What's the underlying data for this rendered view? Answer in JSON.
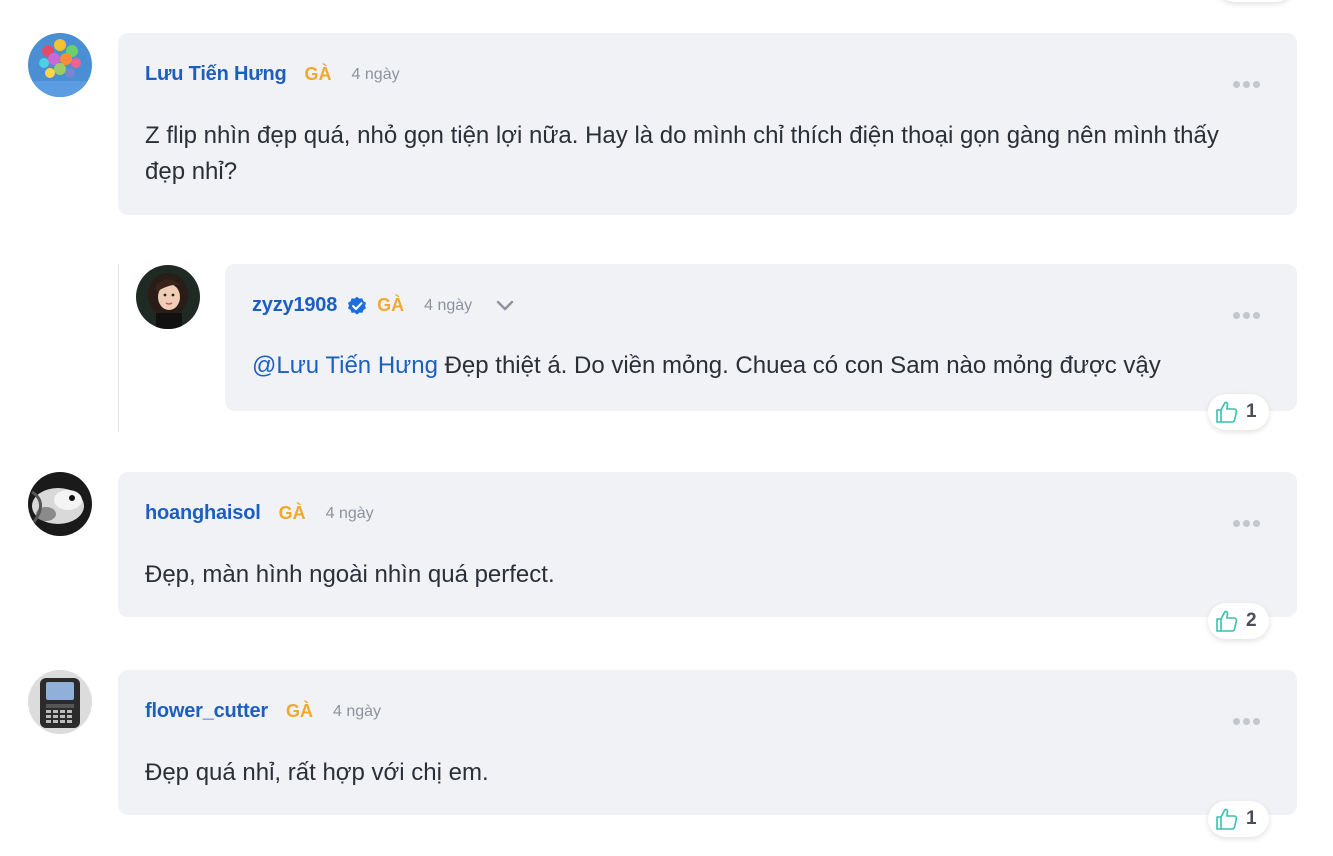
{
  "comments": [
    {
      "username": "Lưu Tiến Hưng",
      "rank": "GÀ",
      "time": "4 ngày",
      "text": "Z flip nhìn đẹp quá, nhỏ gọn tiện lợi nữa. Hay là do mình chỉ thích điện thoại gọn gàng nên mình thấy đẹp nhỉ?",
      "avatar_icon": "balloons-avatar"
    },
    {
      "username": "zyzy1908",
      "verified": true,
      "rank": "GÀ",
      "time": "4 ngày",
      "mention": "@Lưu Tiến Hưng",
      "text": " Đẹp thiệt á. Do viền mỏng. Chuea có con Sam nào mỏng được vậy",
      "likes": "1",
      "avatar_icon": "woman-portrait-avatar"
    },
    {
      "username": "hoanghaisol",
      "rank": "GÀ",
      "time": "4 ngày",
      "text": "Đẹp, màn hình ngoài nhìn quá perfect.",
      "likes": "2",
      "avatar_icon": "bw-animal-avatar"
    },
    {
      "username": "flower_cutter",
      "rank": "GÀ",
      "time": "4 ngày",
      "text": "Đẹp quá nhỉ, rất hợp với chị em.",
      "likes": "1",
      "avatar_icon": "blackberry-phone-avatar"
    }
  ],
  "colors": {
    "username": "#1d5fbf",
    "rank": "#f0a92d",
    "bubble": "#f1f2f6",
    "like_icon": "#3bbfae"
  }
}
